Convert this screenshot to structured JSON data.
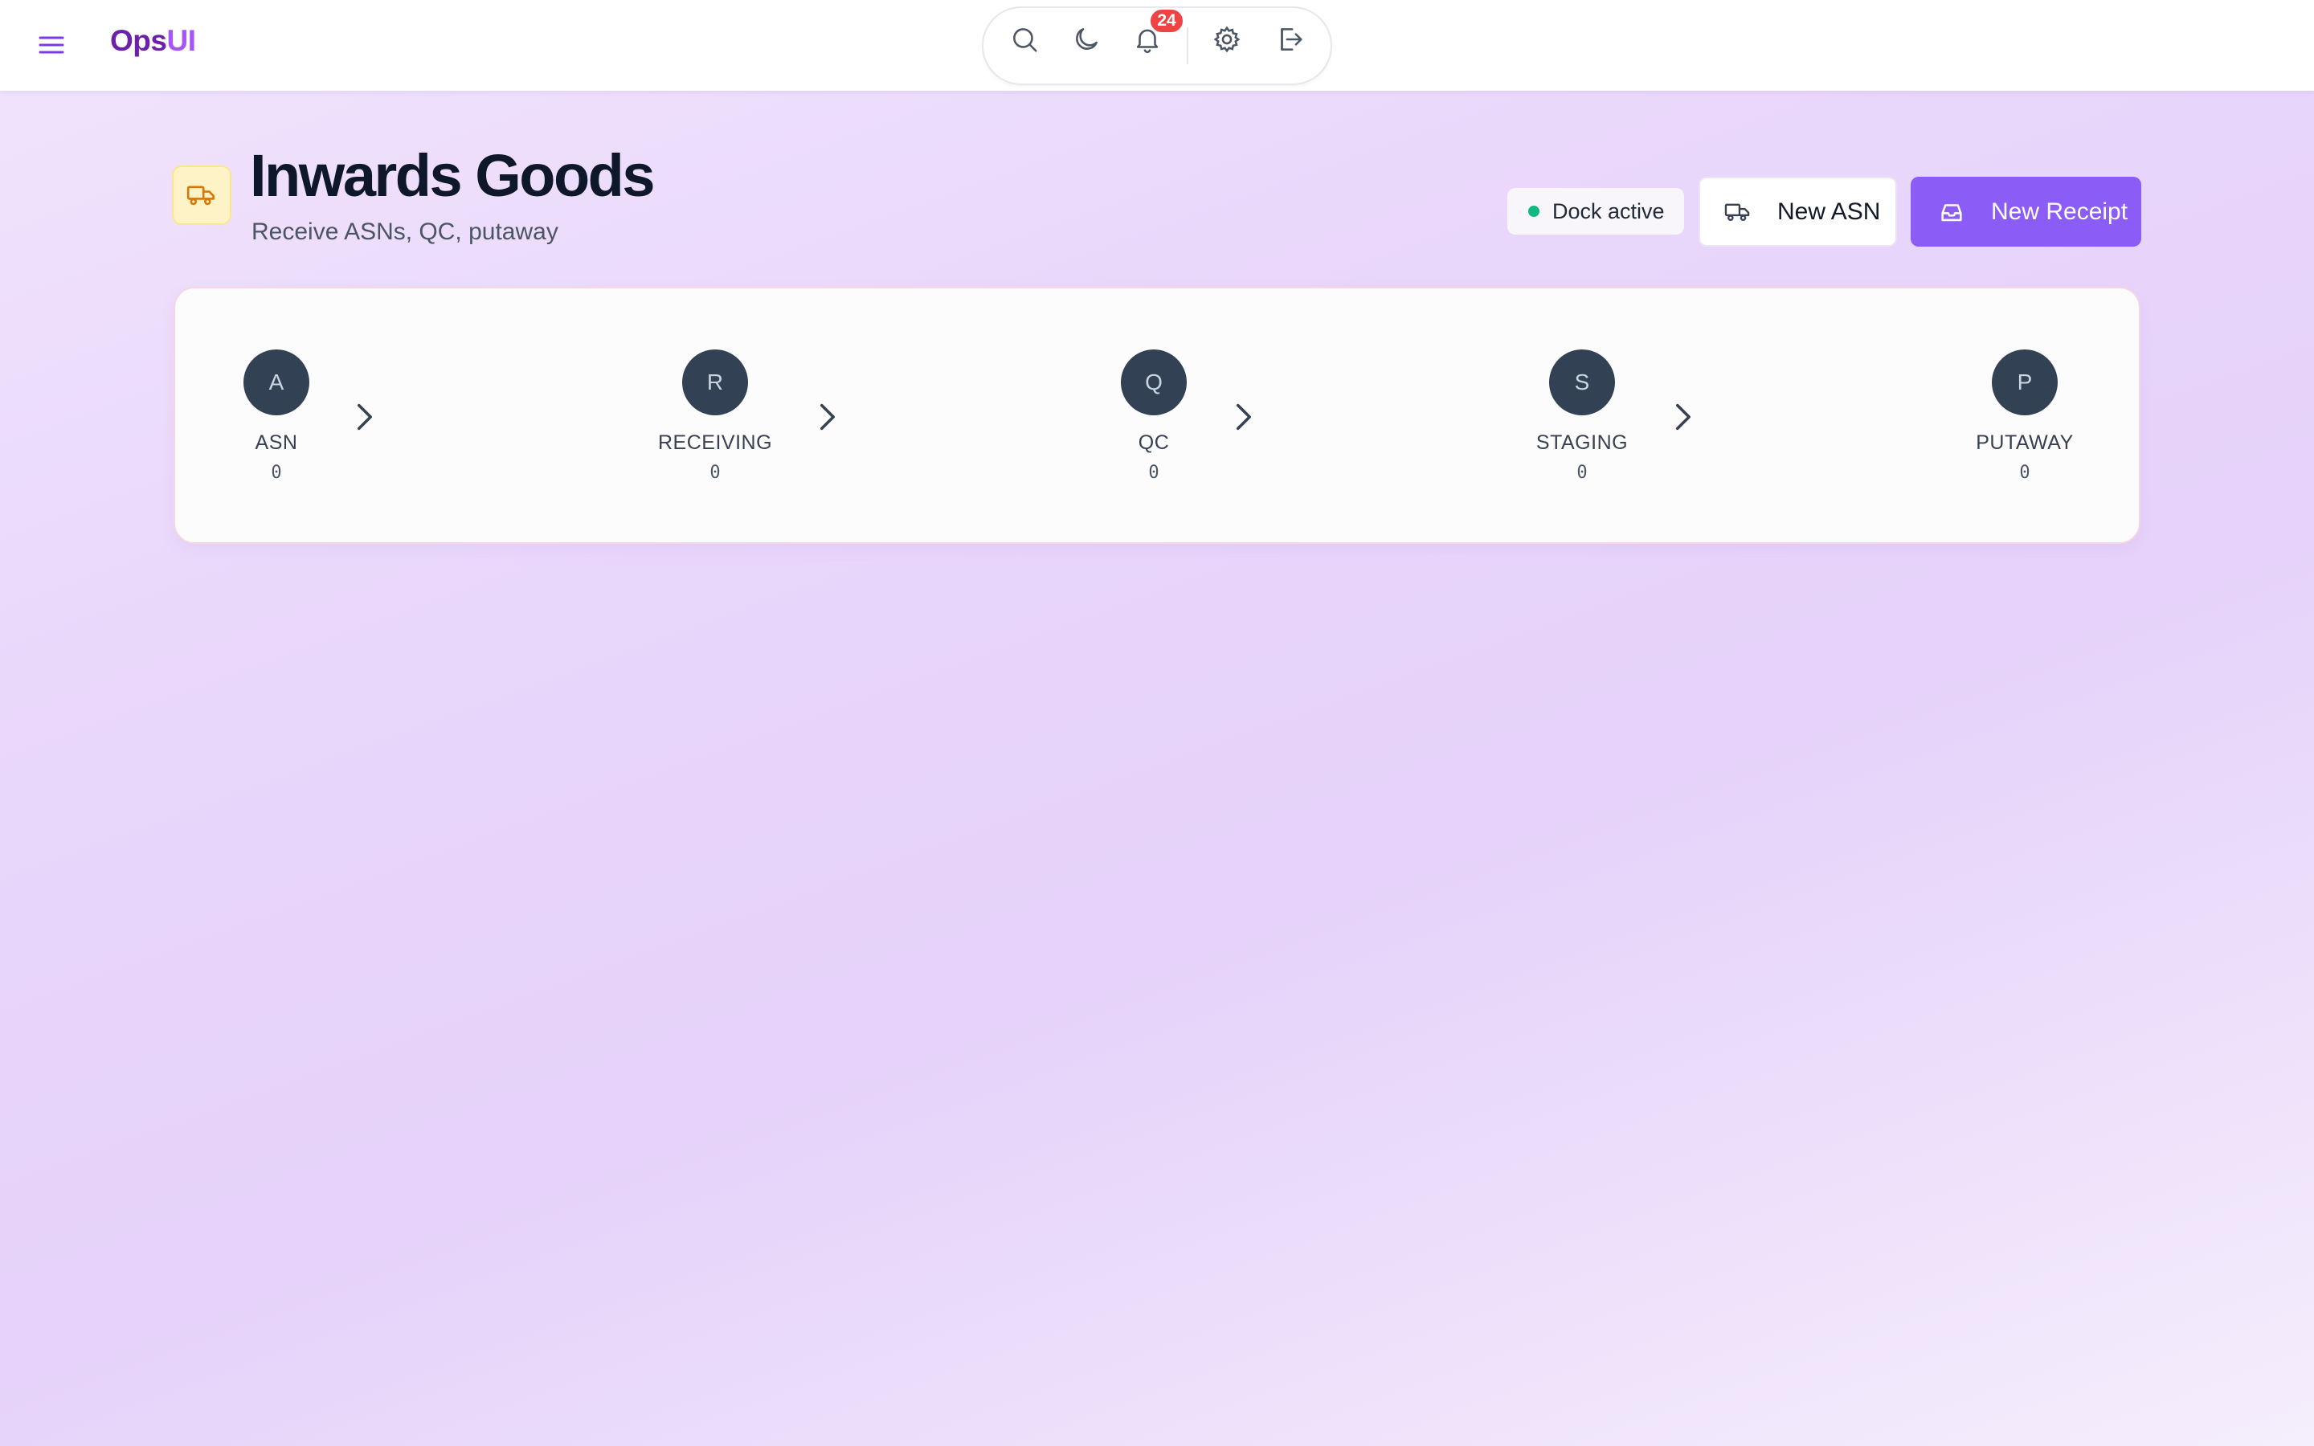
{
  "brand": {
    "part1": "Ops",
    "part2": "UI",
    "color_primary": "#6b21a8",
    "color_secondary": "#a855f7"
  },
  "toolbar": {
    "icons": [
      "search-icon",
      "moon-icon",
      "bell-icon",
      "settings-icon",
      "logout-icon"
    ],
    "notification_count": "24"
  },
  "page": {
    "title": "Inwards Goods",
    "subtitle": "Receive ASNs, QC, putaway",
    "icon": "truck-icon"
  },
  "status": {
    "label": "Dock active",
    "color": "#10b981"
  },
  "actions": {
    "new_asn": {
      "label": "New ASN",
      "icon": "truck-icon"
    },
    "new_receipt": {
      "label": "New Receipt",
      "icon": "inbox-icon",
      "color": "#8b5cf6"
    }
  },
  "pipeline": {
    "stages": [
      {
        "initial": "A",
        "label": "ASN",
        "count": "0"
      },
      {
        "initial": "R",
        "label": "RECEIVING",
        "count": "0"
      },
      {
        "initial": "Q",
        "label": "QC",
        "count": "0"
      },
      {
        "initial": "S",
        "label": "STAGING",
        "count": "0"
      },
      {
        "initial": "P",
        "label": "PUTAWAY",
        "count": "0"
      }
    ]
  }
}
